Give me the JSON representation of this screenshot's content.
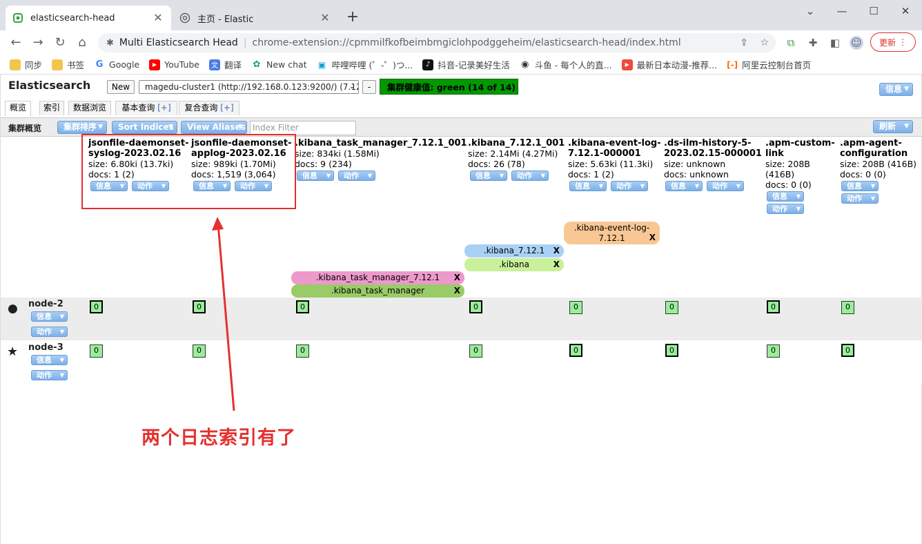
{
  "browser": {
    "tabs": [
      {
        "title": "elasticsearch-head",
        "active": true
      },
      {
        "title": "主页 - Elastic",
        "active": false
      }
    ],
    "omnibox": {
      "site": "Multi Elasticsearch Head",
      "url": "chrome-extension://cpmmilfkofbeimbmgiclohpodggeheim/elasticsearch-head/index.html"
    },
    "update_label": "更新",
    "bookmarks": [
      "同步",
      "书签",
      "Google",
      "YouTube",
      "翻译",
      "New chat",
      "哔哩哔哩 (゜-゜)つ...",
      "抖音-记录美好生活",
      "斗鱼 - 每个人的直...",
      "最新日本动漫-推荐...",
      "阿里云控制台首页"
    ]
  },
  "app": {
    "name": "Elasticsearch",
    "new_label": "New",
    "cluster_select": "magedu-cluster1 (http://192.168.0.123:9200/) (7.12.1)",
    "minus_label": "-",
    "health": "集群健康值: green (14 of 14)",
    "info_label": "信息",
    "refresh_label": "刷新",
    "tabs": [
      "概览",
      "索引",
      "数据浏览",
      "基本查询",
      "复合查询"
    ],
    "tab_plus": "[+]",
    "subbar": {
      "title": "集群概览",
      "sort_label": "集群排序",
      "sort_indices": "Sort Indices",
      "view_aliases": "View Aliases",
      "filter_placeholder": "Index Filter"
    },
    "btn_info": "信息",
    "btn_action": "动作",
    "indices": [
      {
        "name1": "jsonfile-daemonset-",
        "name2": "syslog-2023.02.16",
        "size": "size: 6.80ki (13.7ki)",
        "docs": "docs: 1 (2)"
      },
      {
        "name1": "jsonfile-daemonset-",
        "name2": "applog-2023.02.16",
        "size": "size: 989ki (1.70Mi)",
        "docs": "docs: 1,519 (3,064)"
      },
      {
        "name1": ".kibana_task_manager_7.12.1_001",
        "name2": "",
        "size": "size: 834ki (1.58Mi)",
        "docs": "docs: 9 (234)"
      },
      {
        "name1": ".kibana_7.12.1_001",
        "name2": "",
        "size": "size: 2.14Mi (4.27Mi)",
        "docs": "docs: 26 (78)"
      },
      {
        "name1": ".kibana-event-log-",
        "name2": "7.12.1-000001",
        "size": "size: 5.63ki (11.3ki)",
        "docs": "docs: 1 (2)"
      },
      {
        "name1": ".ds-ilm-history-5-",
        "name2": "2023.02.15-000001",
        "size": "size: unknown",
        "docs": "docs: unknown"
      },
      {
        "name1": ".apm-custom-",
        "name2": "link",
        "size1": "size: 208B",
        "size2": "(416B)",
        "docs": "docs: 0 (0)"
      },
      {
        "name1": ".apm-agent-",
        "name2": "configuration",
        "size": "size: 208B (416B)",
        "docs": "docs: 0 (0)"
      }
    ],
    "aliases": [
      {
        "label1": ".kibana-event-log-",
        "label2": "7.12.1",
        "close": "X",
        "color": "#f9c794"
      },
      {
        "label": ".kibana_7.12.1",
        "close": "X",
        "color": "#a9d1f5"
      },
      {
        "label": ".kibana",
        "close": "X",
        "color": "#c9f09a"
      },
      {
        "label": ".kibana_task_manager_7.12.1",
        "close": "X",
        "color": "#ee99cc"
      },
      {
        "label": ".kibana_task_manager",
        "close": "X",
        "color": "#99cc66"
      }
    ],
    "nodes": [
      {
        "name": "node-2",
        "symbol": "●"
      },
      {
        "name": "node-3",
        "symbol": "★"
      }
    ],
    "shard_label": "0"
  },
  "annotation": "两个日志索引有了"
}
